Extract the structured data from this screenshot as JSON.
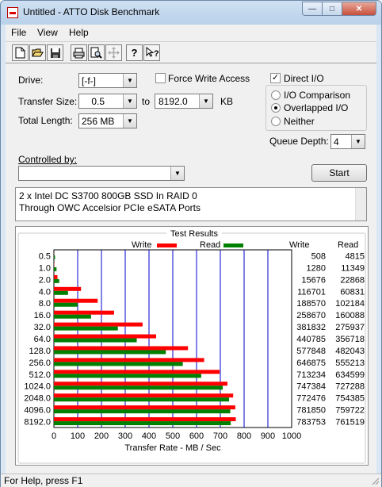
{
  "window": {
    "title": "Untitled - ATTO Disk Benchmark",
    "buttons": {
      "minimize": "—",
      "maximize": "□",
      "close": "✕"
    }
  },
  "menu": [
    "File",
    "View",
    "Help"
  ],
  "toolbar": [
    "new-icon",
    "open-icon",
    "save-icon",
    "print-icon",
    "print-preview-icon",
    "move-icon",
    "help-icon",
    "context-help-icon"
  ],
  "form": {
    "drive_label": "Drive:",
    "drive_value": "[-f-]",
    "force_write_label": "Force Write Access",
    "force_write_checked": false,
    "direct_io_label": "Direct I/O",
    "direct_io_checked": true,
    "transfer_size_label": "Transfer Size:",
    "transfer_from": "0.5",
    "to_label": "to",
    "transfer_to": "8192.0",
    "unit": "KB",
    "total_length_label": "Total Length:",
    "total_length_value": "256 MB",
    "radio_io_comparison": "I/O Comparison",
    "radio_overlapped_io": "Overlapped I/O",
    "radio_neither": "Neither",
    "radio_selected": "Overlapped I/O",
    "queue_depth_label": "Queue Depth:",
    "queue_depth_value": "4",
    "controlled_by_label": "Controlled by:",
    "controlled_by_value": "",
    "start_label": "Start",
    "description_line1": "2 x Intel DC S3700 800GB SSD In RAID 0",
    "description_line2": "Through OWC Accelsior PCIe eSATA Ports"
  },
  "results": {
    "title": "Test Results",
    "legend_write": "Write",
    "legend_read": "Read",
    "col_write": "Write",
    "col_read": "Read",
    "write_color": "#ff0000",
    "read_color": "#008000"
  },
  "chart_data": {
    "type": "bar",
    "orientation": "horizontal",
    "xlabel": "Transfer Rate - MB / Sec",
    "xlim": [
      0,
      1000
    ],
    "xticks": [
      0,
      100,
      200,
      300,
      400,
      500,
      600,
      700,
      800,
      900,
      1000
    ],
    "categories": [
      "0.5",
      "1.0",
      "2.0",
      "4.0",
      "8.0",
      "16.0",
      "32.0",
      "64.0",
      "128.0",
      "256.0",
      "512.0",
      "1024.0",
      "2048.0",
      "4096.0",
      "8192.0"
    ],
    "series": [
      {
        "name": "Write",
        "values": [
          0.5,
          1.2,
          15,
          114,
          184,
          253,
          373,
          430,
          564,
          632,
          697,
          730,
          754,
          763,
          765
        ],
        "table": [
          508,
          1280,
          15676,
          116701,
          188570,
          258670,
          381832,
          440785,
          577848,
          646875,
          713234,
          747384,
          772476,
          781850,
          783753
        ]
      },
      {
        "name": "Read",
        "values": [
          4.7,
          11.1,
          22.4,
          59.4,
          99.7,
          156.3,
          269.1,
          348.4,
          470.7,
          542.2,
          619.7,
          710.3,
          736.7,
          741.9,
          743.7
        ],
        "table": [
          4815,
          11349,
          22868,
          60831,
          102184,
          160088,
          275937,
          356718,
          482043,
          555213,
          634599,
          727288,
          754385,
          759722,
          761519
        ]
      }
    ],
    "grid": true
  },
  "status": {
    "text": "For Help, press F1"
  }
}
